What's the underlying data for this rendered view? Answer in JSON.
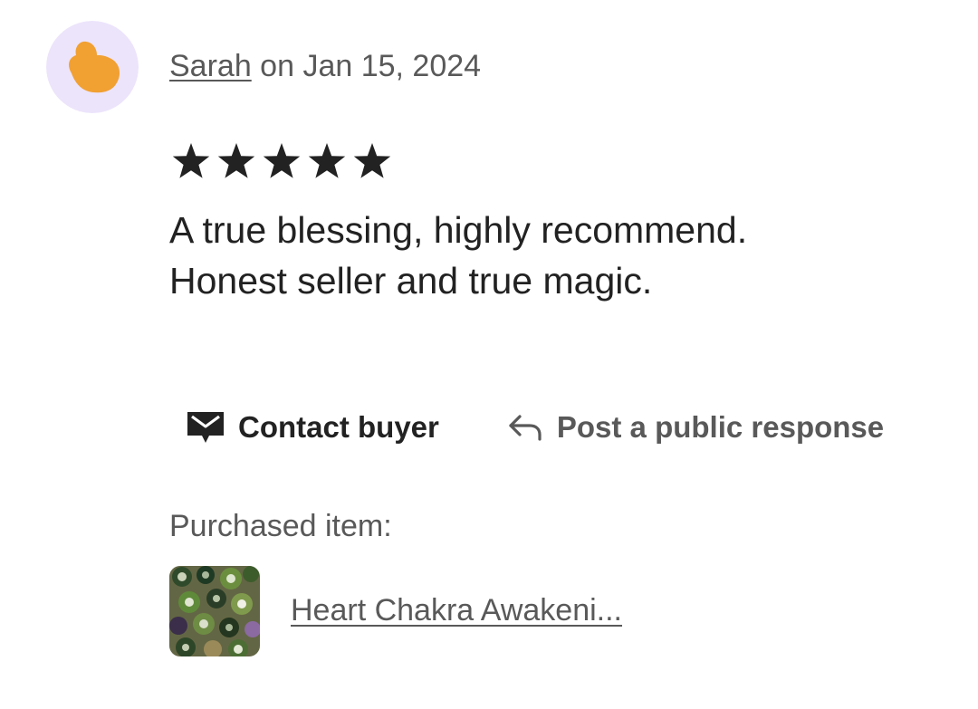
{
  "review": {
    "reviewer_name": "Sarah",
    "date_text": " on Jan 15, 2024",
    "rating": 5,
    "rating_max": 5,
    "text_line1": "A true blessing, highly recommend.",
    "text_line2": "Honest seller and true magic."
  },
  "avatar": {
    "icon": "user-blob-icon",
    "background_color": "#ece4fb",
    "shape_color": "#f1a032"
  },
  "actions": {
    "contact_label": "Contact buyer",
    "contact_icon": "envelope-icon",
    "respond_label": "Post a public response",
    "respond_icon": "reply-arrow-icon"
  },
  "purchase": {
    "label": "Purchased item:",
    "item_title": "Heart Chakra Awakeni...",
    "thumbnail": "item-thumbnail"
  },
  "colors": {
    "text_primary": "#222222",
    "text_secondary": "#595959",
    "star": "#222222"
  }
}
